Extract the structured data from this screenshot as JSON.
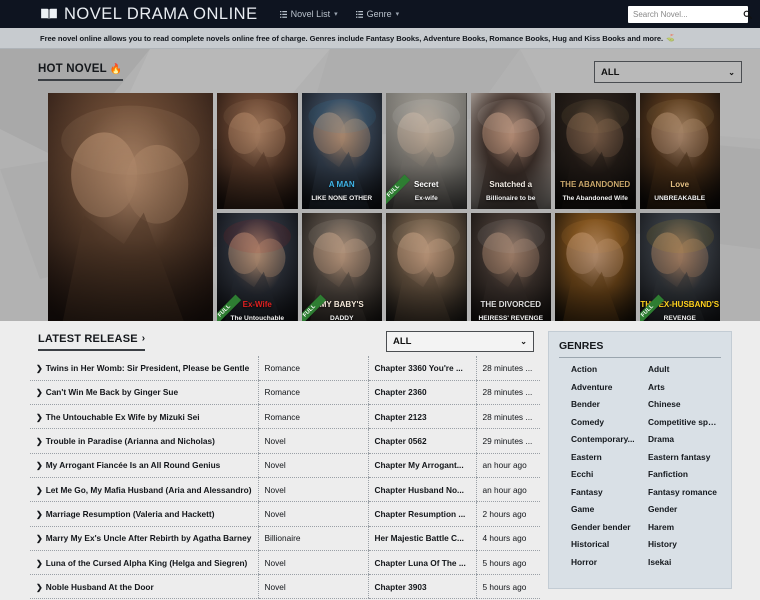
{
  "header": {
    "brand": "NOVEL DRAMA ONLINE",
    "brand_icon": "book-icon",
    "nav": [
      {
        "label": "Novel List",
        "icon": "list-icon",
        "caret": "▾"
      },
      {
        "label": "Genre",
        "icon": "list-icon",
        "caret": "▾"
      }
    ],
    "search_placeholder": "Search Novel...",
    "search_value": "",
    "search_icon": "magnifier-icon",
    "bg_color": "#0e1420"
  },
  "notice": {
    "text": "Free novel online allows you to read complete novels online free of charge. Genres include Fantasy Books, Adventure Books, Romance Books, Hug and Kiss Books and more.",
    "flag": "⛳"
  },
  "hot": {
    "title": "HOT NOVEL",
    "flame_icon": "flame-icon",
    "filter_value": "ALL",
    "filter_caret": "⌄",
    "cards": [
      {
        "title": "",
        "ribbon": "",
        "size": "big",
        "sky": "#2a1a14",
        "mid": "#6b4a34",
        "skin": "#c99a78",
        "accent": "#e8c49a"
      },
      {
        "title": "",
        "ribbon": "",
        "size": "tall",
        "sky": "#241610",
        "mid": "#6a4632",
        "skin": "#c2916f",
        "accent": "#d9b08c"
      },
      {
        "title": "A MAN",
        "subtitle": "LIKE NONE OTHER",
        "ribbon": "",
        "size": "tall",
        "sky": "#13161c",
        "mid": "#3c4a5c",
        "skin": "#c9a183",
        "accent": "#3fb5e8"
      },
      {
        "title": "Secret",
        "subtitle": "Ex-wife",
        "ribbon": "FULL",
        "size": "tall",
        "sky": "#6b6a66",
        "mid": "#9a968e",
        "skin": "#d8c3ae",
        "accent": "#ffffff"
      },
      {
        "title": "Snatched a",
        "subtitle": "Billionaire to be",
        "ribbon": "",
        "size": "tall",
        "sky": "#b9b1aa",
        "mid": "#4a3a33",
        "skin": "#d4a58a",
        "accent": "#f2ece4"
      },
      {
        "title": "THE ABANDONED",
        "subtitle": "The Abandoned Wife",
        "ribbon": "",
        "size": "tall",
        "sky": "#120f0d",
        "mid": "#2a211b",
        "skin": "#8a6a52",
        "accent": "#c8a66a"
      },
      {
        "title": "Love",
        "subtitle": "UNBREAKABLE",
        "ribbon": "",
        "size": "tall",
        "sky": "#120d0a",
        "mid": "#5a3a1e",
        "skin": "#c09878",
        "accent": "#e6c184"
      },
      {
        "title": "Ex-Wife",
        "subtitle": "The Untouchable",
        "ribbon": "FULL",
        "size": "tall",
        "sky": "#0d0f14",
        "mid": "#30353f",
        "skin": "#caa184",
        "accent": "#e02020"
      },
      {
        "title": "MY BABY'S",
        "subtitle": "DADDY",
        "ribbon": "FULL",
        "size": "tall",
        "sky": "#1a1714",
        "mid": "#5a5048",
        "skin": "#cfa98c",
        "accent": "#f3e7d8"
      },
      {
        "title": "",
        "ribbon": "",
        "size": "tall",
        "sky": "#1d1b18",
        "mid": "#6e5a46",
        "skin": "#d6ab8b",
        "accent": "#f0d8bd"
      },
      {
        "title": "THE DIVORCED",
        "subtitle": "HEIRESS' REVENGE",
        "ribbon": "",
        "size": "tall",
        "sky": "#14110f",
        "mid": "#463a34",
        "skin": "#b89279",
        "accent": "#dddddd"
      },
      {
        "title": "",
        "ribbon": "",
        "size": "tall",
        "sky": "#161008",
        "mid": "#7a4e1c",
        "skin": "#cfa27c",
        "accent": "#ffb44d"
      },
      {
        "title": "THE EX-HUSBAND'S",
        "subtitle": "REVENGE",
        "ribbon": "FULL",
        "size": "tall",
        "sky": "#15171b",
        "mid": "#3a3f46",
        "skin": "#b98f70",
        "accent": "#ffd21e"
      }
    ]
  },
  "latest": {
    "title": "LATEST RELEASE",
    "chevron": "›",
    "filter_value": "ALL",
    "filter_caret": "⌄",
    "arrow_icon": "chevron-right-icon",
    "rows": [
      {
        "title": "Twins in Her Womb: Sir President, Please be Gentle",
        "genre": "Romance",
        "chapter": "Chapter 3360 You're ...",
        "time": "28 minutes ..."
      },
      {
        "title": "Can't Win Me Back by Ginger Sue",
        "genre": "Romance",
        "chapter": "Chapter 2360",
        "time": "28 minutes ..."
      },
      {
        "title": "The Untouchable Ex Wife by Mizuki Sei",
        "genre": "Romance",
        "chapter": "Chapter 2123",
        "time": "28 minutes ..."
      },
      {
        "title": "Trouble in Paradise (Arianna and Nicholas)",
        "genre": "Novel",
        "chapter": "Chapter 0562",
        "time": "29 minutes ..."
      },
      {
        "title": "My Arrogant Fiancée Is an All Round Genius",
        "genre": "Novel",
        "chapter": "Chapter My Arrogant...",
        "time": "an hour ago"
      },
      {
        "title": "Let Me Go, My Mafia Husband (Aria and Alessandro)",
        "genre": "Novel",
        "chapter": "Chapter Husband No...",
        "time": "an hour ago"
      },
      {
        "title": "Marriage Resumption (Valeria and Hackett)",
        "genre": "Novel",
        "chapter": "Chapter Resumption ...",
        "time": "2 hours ago"
      },
      {
        "title": "Marry My Ex's Uncle After Rebirth by Agatha Barney",
        "genre": "Billionaire",
        "chapter": "Her Majestic Battle C...",
        "time": "4 hours ago"
      },
      {
        "title": "Luna of the Cursed Alpha King (Helga and Siegren)",
        "genre": "Novel",
        "chapter": "Chapter Luna Of The ...",
        "time": "5 hours ago"
      },
      {
        "title": "Noble Husband At the Door",
        "genre": "Novel",
        "chapter": "Chapter 3903",
        "time": "5 hours ago"
      }
    ]
  },
  "genres": {
    "title": "GENRES",
    "items": [
      "Action",
      "Adult",
      "Adventure",
      "Arts",
      "Bender",
      "Chinese",
      "Comedy",
      "Competitive sports",
      "Contemporary...",
      "Drama",
      "Eastern",
      "Eastern fantasy",
      "Ecchi",
      "Fanfiction",
      "Fantasy",
      "Fantasy romance",
      "Game",
      "Gender",
      "Gender bender",
      "Harem",
      "Historical",
      "History",
      "Horror",
      "Isekai"
    ]
  },
  "colors": {
    "nav_bg": "#0e1420",
    "notice_bg": "#c7cbcf",
    "hot_bg": "#b2b2b2",
    "content_bg": "#ededed",
    "genres_bg": "#d9e0e6",
    "link": "#1b4f8a",
    "ribbon": "#2e7d32"
  }
}
